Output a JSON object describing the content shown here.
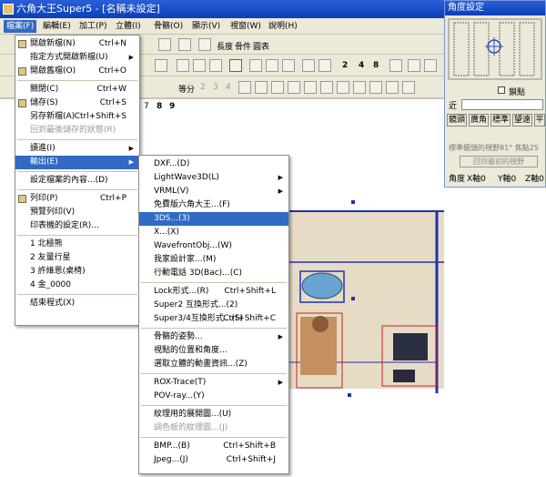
{
  "window": {
    "title": "六角大王Super5 - [名稱未設定]"
  },
  "menubar": [
    {
      "label": "檔案(F)",
      "active": true
    },
    {
      "label": "編輯(E)",
      "active": false
    },
    {
      "label": "加工(P)",
      "active": false
    },
    {
      "label": "立體(I)",
      "active": false
    },
    {
      "label": "骨骼(O)",
      "active": false
    },
    {
      "label": "顯示(V)",
      "active": false
    },
    {
      "label": "視窗(W)",
      "active": false
    },
    {
      "label": "說明(H)",
      "active": false
    }
  ],
  "toolbar": {
    "row1": [
      "長度",
      "骨件",
      "圓表"
    ],
    "row2_nums": [
      "2",
      "4",
      "8"
    ],
    "row3_label": "等分",
    "row3_nums": [
      "2",
      "3",
      "4"
    ],
    "row4_nums": [
      "7",
      "8",
      "9"
    ]
  },
  "file_menu": [
    {
      "label": "開啟新檔(N)",
      "shortcut": "Ctrl+N",
      "icon": true
    },
    {
      "label": "指定方式開啟新檔(U)",
      "shortcut": "",
      "submenu": true
    },
    {
      "label": "開啟舊檔(O)",
      "shortcut": "Ctrl+O",
      "icon": true
    },
    {
      "sep": true
    },
    {
      "label": "關閉(C)",
      "shortcut": "Ctrl+W"
    },
    {
      "label": "儲存(S)",
      "shortcut": "Ctrl+S",
      "icon": true
    },
    {
      "label": "另存新檔(A)",
      "shortcut": "Ctrl+Shift+S"
    },
    {
      "label": "回到最後儲存的狀態(R)",
      "shortcut": "",
      "disabled": true
    },
    {
      "sep": true
    },
    {
      "label": "讀進(I)",
      "submenu": true
    },
    {
      "label": "輸出(E)",
      "submenu": true,
      "highlight": true
    },
    {
      "sep": true
    },
    {
      "label": "設定檔案的內容...(D)"
    },
    {
      "sep": true
    },
    {
      "label": "列印(P)",
      "shortcut": "Ctrl+P",
      "icon": true
    },
    {
      "label": "預覽列印(V)"
    },
    {
      "label": "印表機的設定(R)..."
    },
    {
      "sep": true
    },
    {
      "label": "1 北極熊"
    },
    {
      "label": "2 友量行星"
    },
    {
      "label": "3 許維恩(桌椅)"
    },
    {
      "label": "4 金_0000"
    },
    {
      "sep": true
    },
    {
      "label": "結束程式(X)"
    }
  ],
  "export_menu": [
    {
      "label": "DXF...(D)"
    },
    {
      "label": "LightWave3D(L)",
      "submenu": true
    },
    {
      "label": "VRML(V)",
      "submenu": true
    },
    {
      "label": "免費版六角大王...(F)"
    },
    {
      "label": "3DS...(3)",
      "highlight": true
    },
    {
      "label": "X...(X)"
    },
    {
      "label": "WavefrontObj...(W)"
    },
    {
      "label": "我家設計家...(M)"
    },
    {
      "label": "行動電話 3D(Bac)...(C)"
    },
    {
      "sep": true
    },
    {
      "label": "Lock形式...(R)",
      "shortcut": "Ctrl+Shift+L"
    },
    {
      "label": "Super2 互換形式...(2)"
    },
    {
      "label": "Super3/4互換形式...(S)",
      "shortcut": "Ctrl+Shift+C"
    },
    {
      "sep": true
    },
    {
      "label": "骨骼的姿勢...",
      "submenu": true
    },
    {
      "label": "視點的位置和角度..."
    },
    {
      "label": "選取立體的動畫資訊...(Z)"
    },
    {
      "sep": true
    },
    {
      "label": "ROX-Trace(T)",
      "submenu": true
    },
    {
      "label": "POV-ray...(Y)"
    },
    {
      "sep": true
    },
    {
      "label": "紋理用的展開圖...(U)"
    },
    {
      "label": "調色板的紋理圖...(J)",
      "disabled": true
    },
    {
      "sep": true
    },
    {
      "label": "BMP...(B)",
      "shortcut": "Ctrl+Shift+B"
    },
    {
      "label": "Jpeg...(J)",
      "shortcut": "Ctrl+Shift+J"
    }
  ],
  "angle_panel": {
    "title": "角度設定",
    "checkbox": "鎖點",
    "near_label": "近",
    "lens_buttons": [
      "鏡頭",
      "廣角",
      "標準",
      "望遠",
      "平"
    ],
    "info_text": "標準鏡頭的視野81° 焦點25",
    "reset_button": "回到最初的視野",
    "angle_label": "角度",
    "x_readout": "X軸0",
    "y_readout": "Y軸0",
    "z_readout": "Z軸0"
  },
  "colors": {
    "menu_highlight": "#316ac5",
    "titlebar": "#0a3fb8",
    "wall": "#e6dcc6",
    "selection": "#d21a1a"
  }
}
